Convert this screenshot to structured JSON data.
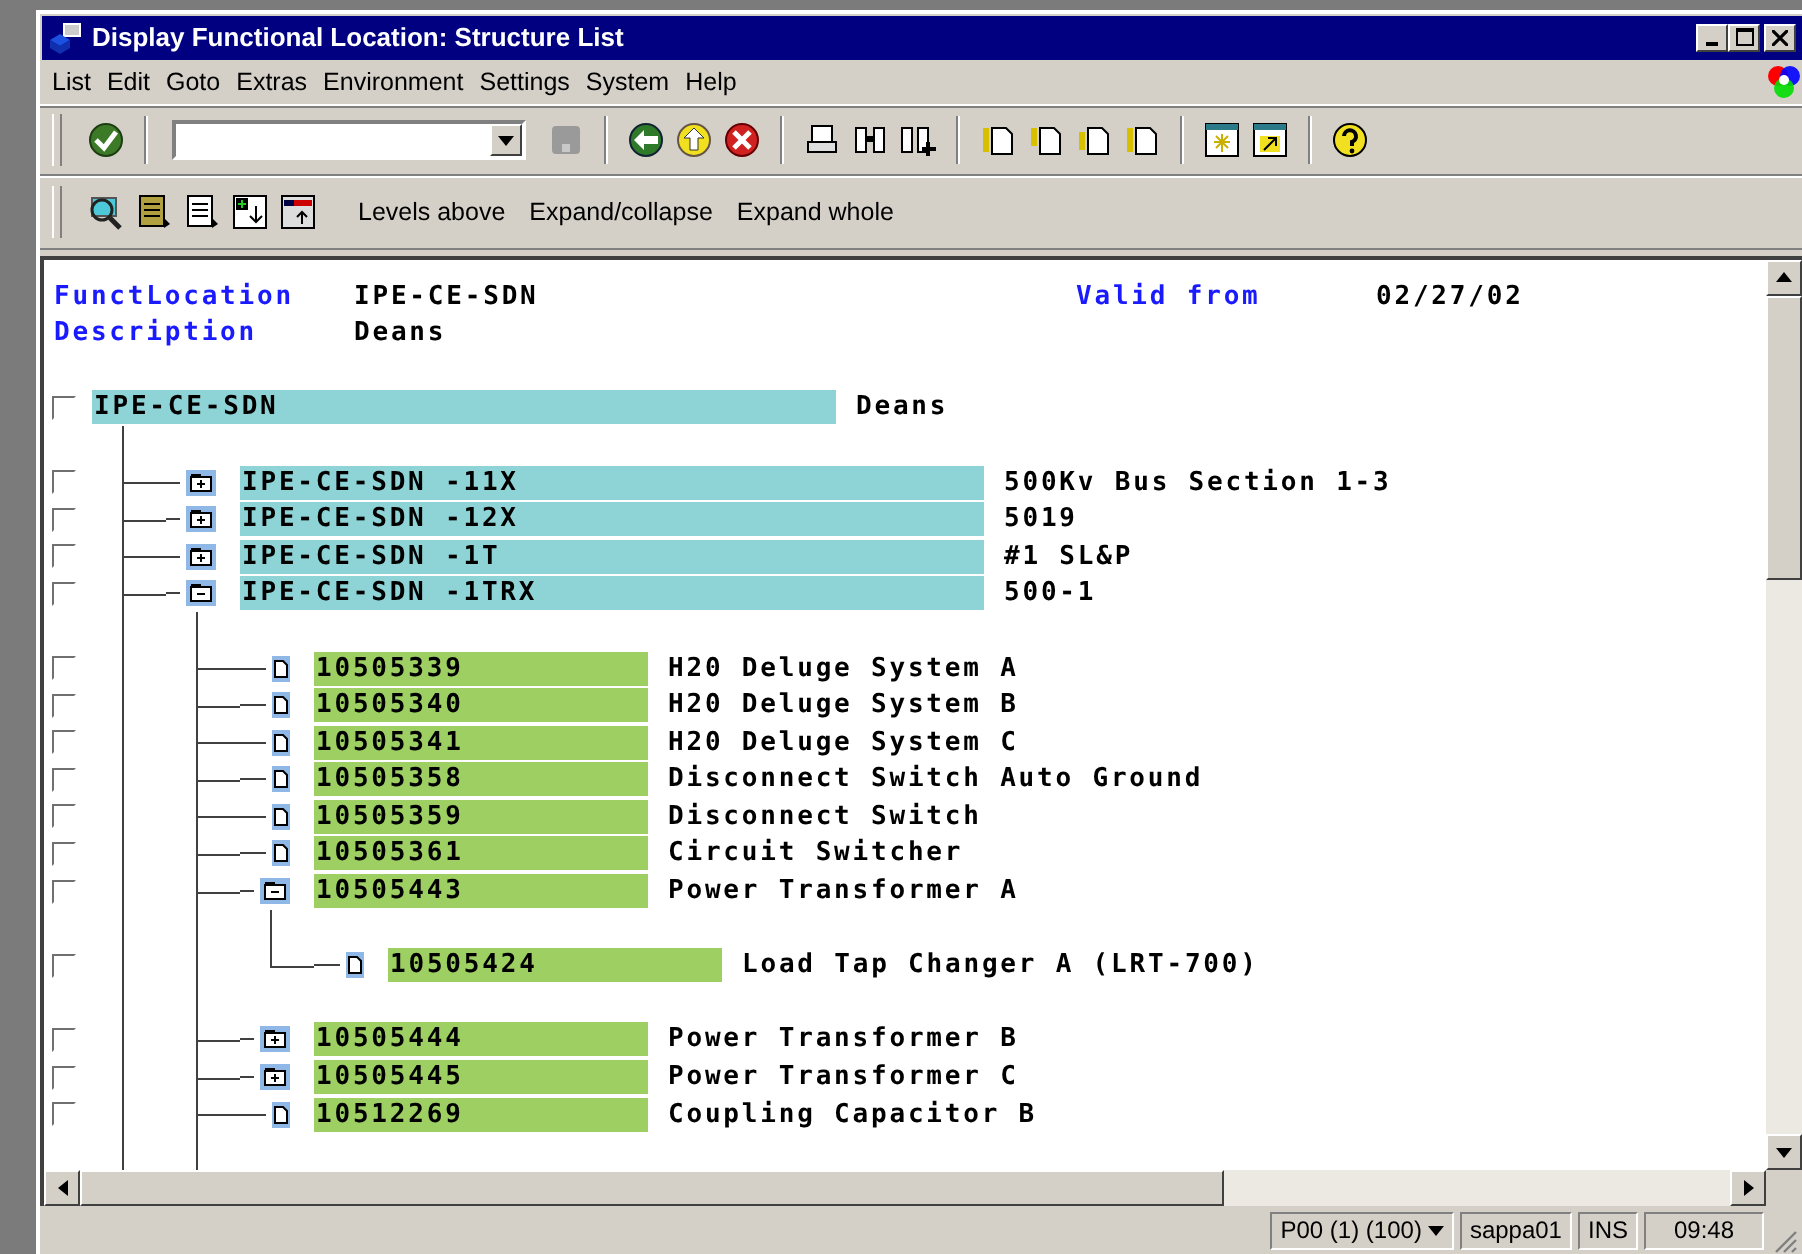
{
  "window": {
    "title": "Display Functional Location: Structure List"
  },
  "menu": [
    "List",
    "Edit",
    "Goto",
    "Extras",
    "Environment",
    "Settings",
    "System",
    "Help"
  ],
  "app_toolbar": [
    "Levels above",
    "Expand/collapse",
    "Expand whole"
  ],
  "header": {
    "fields": [
      {
        "label": "FunctLocation",
        "value": "IPE-CE-SDN"
      },
      {
        "label": "Description",
        "value": "Deans"
      }
    ],
    "valid_from": {
      "label": "Valid from",
      "value": "02/27/02"
    }
  },
  "tree": {
    "label": "IPE-CE-SDN",
    "description": "Deans",
    "checked": false,
    "kind": "location",
    "children": [
      {
        "label": "IPE-CE-SDN -11X",
        "description": "500Kv Bus Section 1-3",
        "checked": false,
        "kind": "location",
        "leaf": false,
        "expanded": false
      },
      {
        "label": "IPE-CE-SDN -12X",
        "description": "5019",
        "checked": false,
        "kind": "location",
        "leaf": false,
        "expanded": false
      },
      {
        "label": "IPE-CE-SDN -1T",
        "description": "#1 SL&P",
        "checked": false,
        "kind": "location",
        "leaf": false,
        "expanded": false
      },
      {
        "label": "IPE-CE-SDN -1TRX",
        "description": "500-1",
        "checked": false,
        "kind": "location",
        "leaf": false,
        "expanded": true,
        "children": [
          {
            "label": "10505339",
            "description": "H20 Deluge System A",
            "checked": false,
            "kind": "equipment",
            "leaf": true
          },
          {
            "label": "10505340",
            "description": "H20 Deluge System B",
            "checked": false,
            "kind": "equipment",
            "leaf": true
          },
          {
            "label": "10505341",
            "description": "H20 Deluge System C",
            "checked": false,
            "kind": "equipment",
            "leaf": true
          },
          {
            "label": "10505358",
            "description": "Disconnect Switch Auto Ground",
            "checked": false,
            "kind": "equipment",
            "leaf": true
          },
          {
            "label": "10505359",
            "description": "Disconnect Switch",
            "checked": false,
            "kind": "equipment",
            "leaf": true
          },
          {
            "label": "10505361",
            "description": "Circuit Switcher",
            "checked": false,
            "kind": "equipment",
            "leaf": true
          },
          {
            "label": "10505443",
            "description": "Power Transformer A",
            "checked": false,
            "kind": "equipment",
            "leaf": false,
            "expanded": true,
            "children": [
              {
                "label": "10505424",
                "description": "Load Tap Changer A (LRT-700)",
                "checked": false,
                "kind": "equipment",
                "leaf": true
              }
            ]
          },
          {
            "label": "10505444",
            "description": "Power Transformer B",
            "checked": false,
            "kind": "equipment",
            "leaf": false,
            "expanded": false
          },
          {
            "label": "10505445",
            "description": "Power Transformer C",
            "checked": false,
            "kind": "equipment",
            "leaf": false,
            "expanded": false
          },
          {
            "label": "10512269",
            "description": "Coupling Capacitor B",
            "checked": false,
            "kind": "equipment",
            "leaf": true
          }
        ]
      }
    ]
  },
  "status_bar": {
    "session": "P00 (1) (100)",
    "user": "sappa01",
    "mode": "INS",
    "time": "09:48"
  }
}
